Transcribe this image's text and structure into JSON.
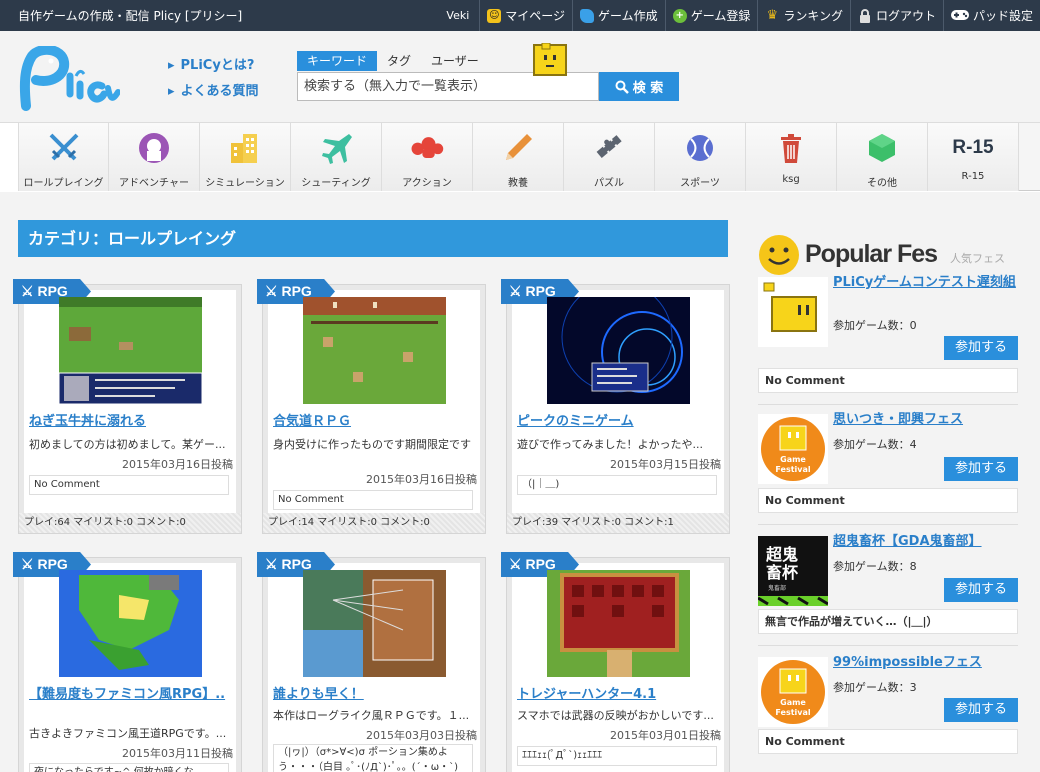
{
  "topbar": {
    "site_title": "自作ゲームの作成・配信 Plicy [プリシー]",
    "user": "Veki",
    "nav": [
      {
        "label": "マイページ",
        "icon": "mypage-icon",
        "color": "#f2c21b"
      },
      {
        "label": "ゲーム作成",
        "icon": "create-icon",
        "color": "#3aa0e8"
      },
      {
        "label": "ゲーム登録",
        "icon": "plus-icon",
        "color": "#6cbf3b"
      },
      {
        "label": "ランキング",
        "icon": "trophy-icon",
        "color": "#e8b81b"
      },
      {
        "label": "ログアウト",
        "icon": "lock-icon",
        "color": "#cccccc"
      },
      {
        "label": "パッド設定",
        "icon": "gamepad-icon",
        "color": "#ffffff"
      }
    ]
  },
  "header": {
    "logo_text": "Plicy",
    "links": [
      "PLiCyとは?",
      "よくある質問"
    ],
    "search": {
      "tabs": [
        "キーワード",
        "タグ",
        "ユーザー"
      ],
      "placeholder": "検索する（無入力で一覧表示）",
      "button": "検 索"
    }
  },
  "categories": [
    {
      "label": "ロールプレイング",
      "icon": "swords-icon"
    },
    {
      "label": "アドベンチャー",
      "icon": "adventure-icon"
    },
    {
      "label": "シミュレーション",
      "icon": "buildings-icon"
    },
    {
      "label": "シューティング",
      "icon": "jet-icon"
    },
    {
      "label": "アクション",
      "icon": "action-icon"
    },
    {
      "label": "教養",
      "icon": "pencil-icon"
    },
    {
      "label": "パズル",
      "icon": "puzzle-icon"
    },
    {
      "label": "スポーツ",
      "icon": "ball-icon"
    },
    {
      "label": "ksg",
      "icon": "trash-icon"
    },
    {
      "label": "その他",
      "icon": "cube-icon"
    },
    {
      "label": "R-15",
      "icon_text": "R-15"
    }
  ],
  "main": {
    "heading": "カテゴリ：ロールプレイング",
    "badge_label": "RPG",
    "games": [
      {
        "title": "ねぎ玉牛丼に溺れる",
        "desc": "初めましての方は初めまして。某ゲー...",
        "date": "2015年03月16日投稿",
        "comment": "No Comment",
        "stats": "プレイ:64 マイリスト:0 コメント:0"
      },
      {
        "title": "合気道ＲＰＧ",
        "desc": "身内受けに作ったものです期間限定です",
        "date": "2015年03月16日投稿",
        "comment": "No Comment",
        "stats": "プレイ:14 マイリスト:0 コメント:0"
      },
      {
        "title": "ピークのミニゲーム",
        "desc": "遊びで作ってみました！よかったや...",
        "date": "2015年03月15日投稿",
        "comment": "（|｜＿)",
        "stats": "プレイ:39 マイリスト:0 コメント:1"
      },
      {
        "title": "【難易度もファミコン風RPG】..",
        "desc": "古きよきファミコン風王道RPGです。...",
        "date": "2015年03月11日投稿",
        "comment": "夜になったらです~^ 何故か暗くな...",
        "stats": ""
      },
      {
        "title": "誰よりも早く！",
        "desc": "本作はローグライク風ＲＰＧです。１...",
        "date": "2015年03月03日投稿",
        "comment": "（|ヮ|）（σ*>∀<)σ ポーション集めよう・・・（白目 ｡ﾟ･(ﾉД`)･ﾟ｡。(´・ω・`)",
        "stats": ""
      },
      {
        "title": "トレジャーハンター4.1",
        "desc": "スマホでは武器の反映がおかしいです...",
        "date": "2015年03月01日投稿",
        "comment": "ｴｴｴｪｪ(ﾟДﾟ`)ｪｪｴｴｴ",
        "stats": ""
      }
    ]
  },
  "sidebar": {
    "popular_title": "Popular Fes",
    "popular_sub": "人気フェス",
    "fes": [
      {
        "name": "PLiCyゲームコンテスト遅刻組",
        "count": "参加ゲーム数：0",
        "join": "参加する",
        "comment": "No Comment",
        "image_text": ""
      },
      {
        "name": "思いつき・即興フェス",
        "count": "参加ゲーム数：4",
        "join": "参加する",
        "comment": "No Comment",
        "image_text": "Game Festival"
      },
      {
        "name": "超鬼畜杯【GDA鬼畜部】",
        "count": "参加ゲーム数：8",
        "join": "参加する",
        "comment": "無言で作品が増えていく…（|＿|）",
        "image_text": "超鬼畜杯"
      },
      {
        "name": "99%impossibleフェス",
        "count": "参加ゲーム数：3",
        "join": "参加する",
        "comment": "No Comment",
        "image_text": "Game Festival"
      }
    ]
  },
  "colors": {
    "topbar": "#2d3a4a",
    "accent": "#2a8fdc",
    "link": "#2a7fc9"
  }
}
